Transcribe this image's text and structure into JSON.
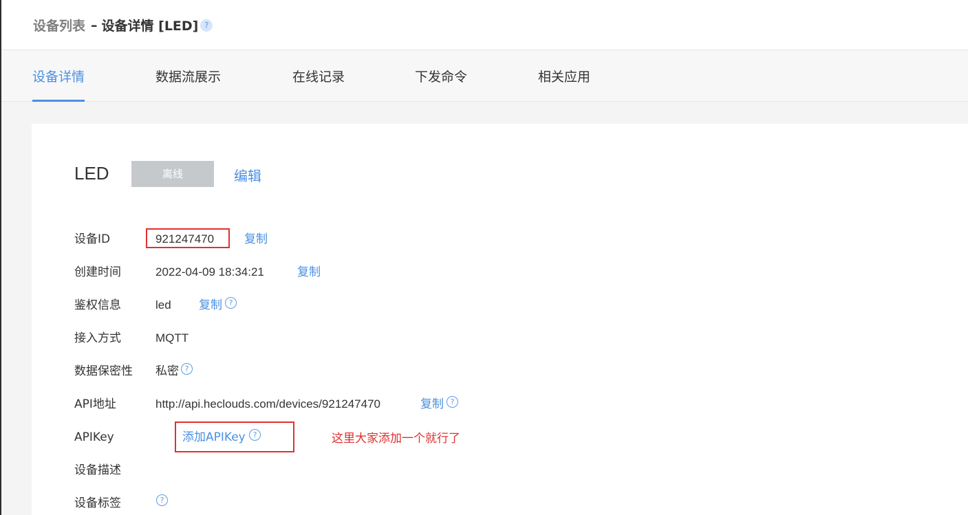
{
  "breadcrumb": {
    "parent": "设备列表",
    "separator": "–",
    "current": "设备详情 [LED]",
    "help": "?"
  },
  "tabs": [
    {
      "label": "设备详情",
      "active": true
    },
    {
      "label": "数据流展示",
      "active": false
    },
    {
      "label": "在线记录",
      "active": false
    },
    {
      "label": "下发命令",
      "active": false
    },
    {
      "label": "相关应用",
      "active": false
    }
  ],
  "device": {
    "name": "LED",
    "status": "离线",
    "edit_label": "编辑"
  },
  "fields": {
    "device_id": {
      "label": "设备ID",
      "value": "921247470",
      "action": "复制"
    },
    "created_time": {
      "label": "创建时间",
      "value": "2022-04-09 18:34:21",
      "action": "复制"
    },
    "auth_info": {
      "label": "鉴权信息",
      "value": "led",
      "action": "复制",
      "help": "?"
    },
    "access_method": {
      "label": "接入方式",
      "value": "MQTT"
    },
    "data_privacy": {
      "label": "数据保密性",
      "value": "私密",
      "help": "?"
    },
    "api_address": {
      "label": "API地址",
      "value": "http://api.heclouds.com/devices/921247470",
      "action": "复制",
      "help": "?"
    },
    "api_key": {
      "label": "APIKey",
      "action": "添加APIKey",
      "help": "?"
    },
    "description": {
      "label": "设备描述"
    },
    "tags": {
      "label": "设备标签",
      "help": "?"
    }
  },
  "annotation": "这里大家添加一个就行了",
  "colors": {
    "accent": "#4a90e2",
    "annotation_red": "#e03030",
    "status_gray": "#c6c9cc"
  }
}
